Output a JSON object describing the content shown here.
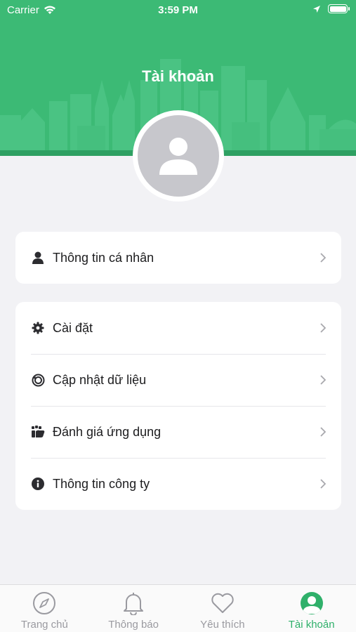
{
  "status_bar": {
    "carrier": "Carrier",
    "time": "3:59 PM"
  },
  "header": {
    "title": "Tài khoản",
    "background_color": "#3cba75"
  },
  "profile_group": {
    "items": [
      {
        "label": "Thông tin cá nhân",
        "icon": "user-icon"
      }
    ]
  },
  "settings_group": {
    "items": [
      {
        "label": "Cài đặt",
        "icon": "gear-icon"
      },
      {
        "label": "Cập nhật dữ liệu",
        "icon": "sync-icon"
      },
      {
        "label": "Đánh giá ứng dụng",
        "icon": "rate-icon"
      },
      {
        "label": "Thông tin công ty",
        "icon": "info-icon"
      }
    ]
  },
  "tab_bar": {
    "active_color": "#2fb06a",
    "inactive_color": "#9a9aa0",
    "tabs": [
      {
        "label": "Trang chủ",
        "icon": "compass-icon",
        "active": false
      },
      {
        "label": "Thông báo",
        "icon": "bell-icon",
        "active": false
      },
      {
        "label": "Yêu thích",
        "icon": "heart-icon",
        "active": false
      },
      {
        "label": "Tài khoản",
        "icon": "account-icon",
        "active": true
      }
    ]
  }
}
